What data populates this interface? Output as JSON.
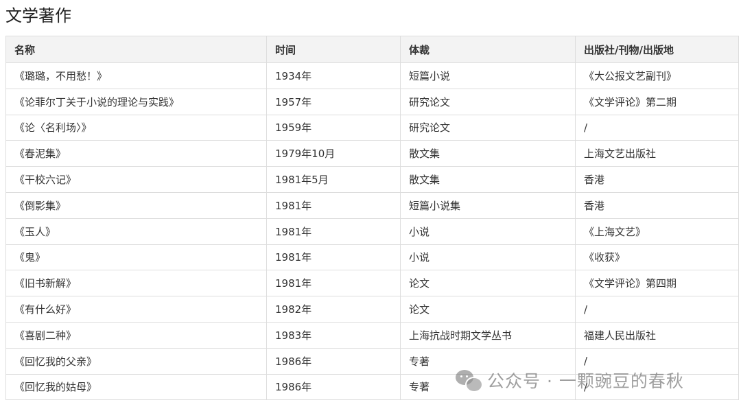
{
  "title": "文学著作",
  "table": {
    "headers": [
      "名称",
      "时间",
      "体裁",
      "出版社/刊物/出版地"
    ],
    "rows": [
      [
        "《璐璐，不用愁！》",
        "1934年",
        "短篇小说",
        "《大公报文艺副刊》"
      ],
      [
        "《论菲尔丁关于小说的理论与实践》",
        "1957年",
        "研究论文",
        "《文学评论》第二期"
      ],
      [
        "《论〈名利场〉》",
        "1959年",
        "研究论文",
        "/"
      ],
      [
        "《春泥集》",
        "1979年10月",
        "散文集",
        "上海文艺出版社"
      ],
      [
        "《干校六记》",
        "1981年5月",
        "散文集",
        "香港"
      ],
      [
        "《倒影集》",
        "1981年",
        "短篇小说集",
        "香港"
      ],
      [
        "《玉人》",
        "1981年",
        "小说",
        "《上海文艺》"
      ],
      [
        "《鬼》",
        "1981年",
        "小说",
        "《收获》"
      ],
      [
        "《旧书新解》",
        "1981年",
        "论文",
        "《文学评论》第四期"
      ],
      [
        "《有什么好》",
        "1982年",
        "论文",
        "/"
      ],
      [
        "《喜剧二种》",
        "1983年",
        "上海抗战时期文学丛书",
        "福建人民出版社"
      ],
      [
        "《回忆我的父亲》",
        "1986年",
        "专著",
        "/"
      ],
      [
        "《回忆我的姑母》",
        "1986年",
        "专著",
        "/"
      ]
    ]
  },
  "watermark": {
    "text": "公众号 · 一颗豌豆的春秋",
    "icon": "wechat-icon"
  }
}
